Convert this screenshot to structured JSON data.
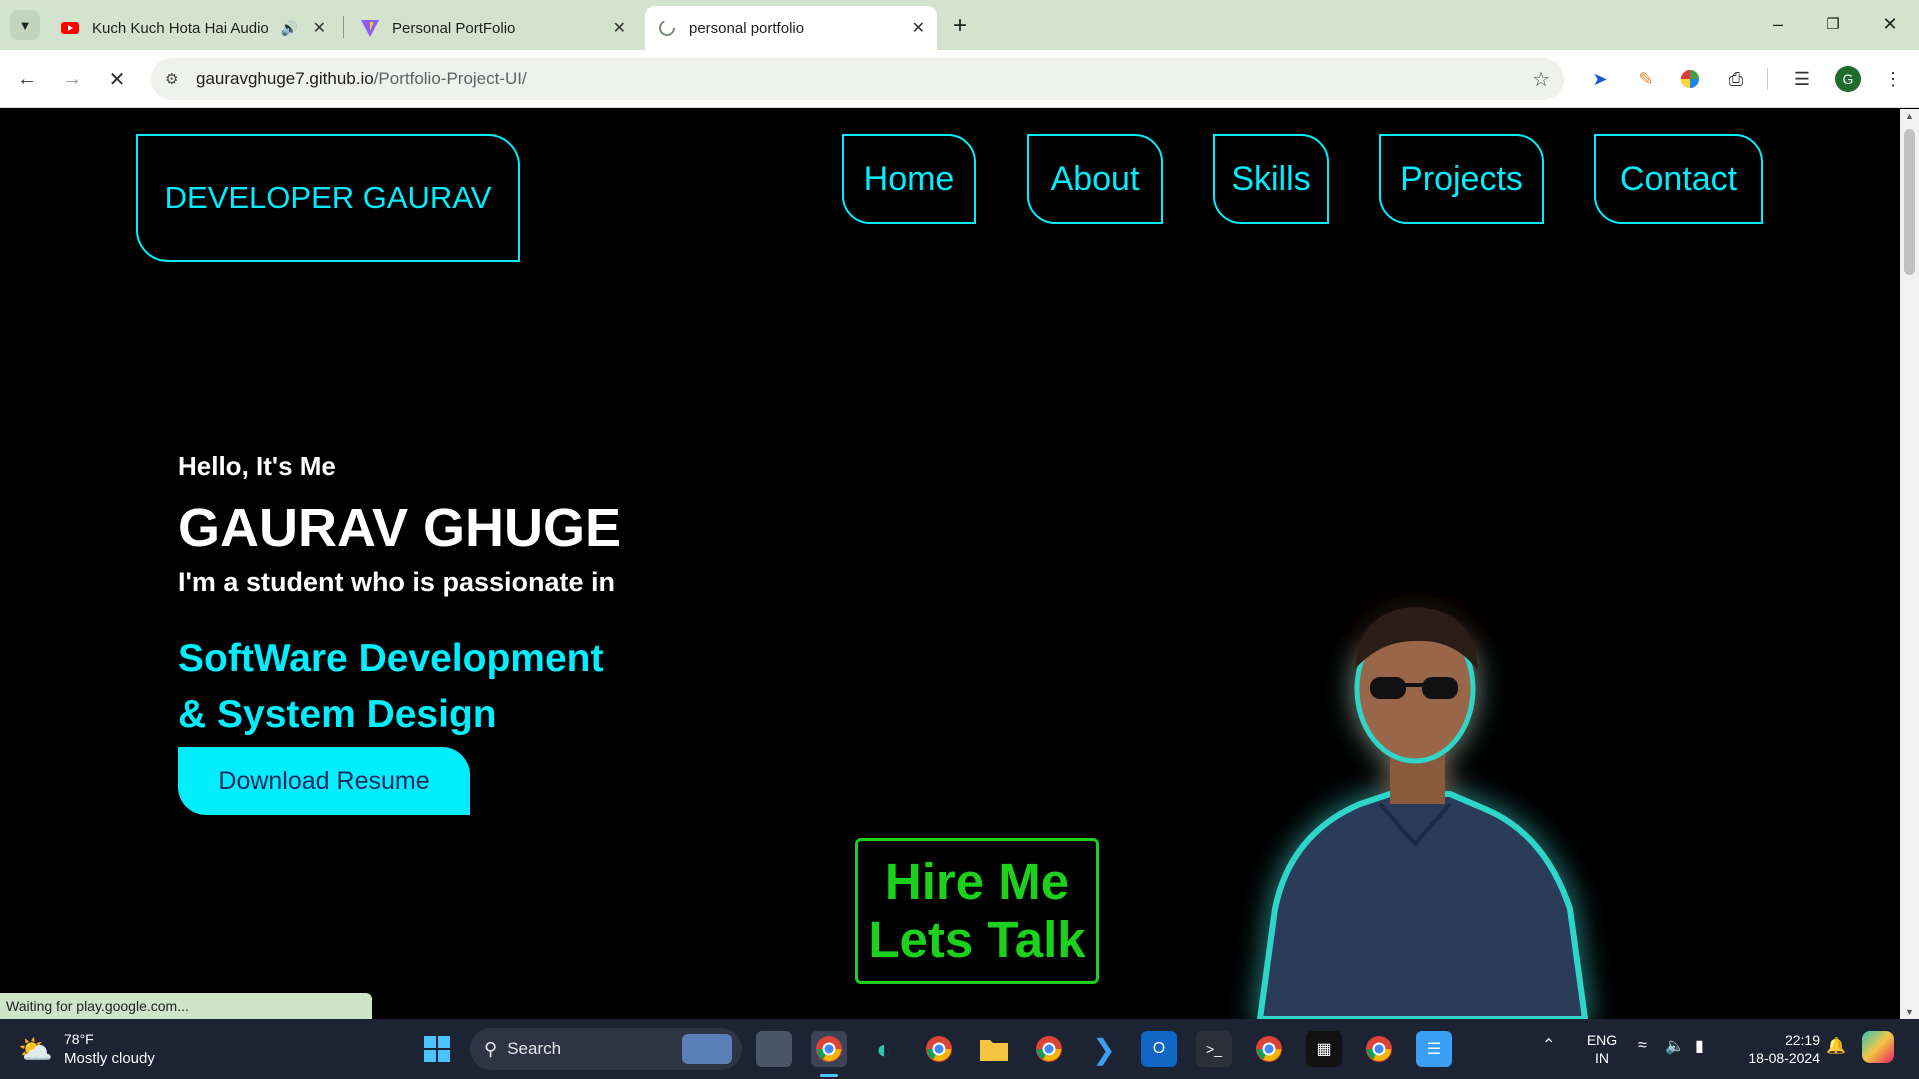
{
  "browser": {
    "tabs": [
      {
        "title": "Kuch Kuch Hota Hai Audio",
        "favicon": "youtube-icon",
        "audio": true
      },
      {
        "title": "Personal PortFolio",
        "favicon": "vite-icon"
      },
      {
        "title": "personal portfolio",
        "favicon": "loading-icon",
        "active": true
      }
    ],
    "url_host": "gauravghuge7.github.io",
    "url_path": "/Portfolio-Project-UI/",
    "status_text": "Waiting for play.google.com...",
    "profile_initial": "G"
  },
  "site": {
    "logo": "DEVELOPER GAURAV",
    "nav": [
      "Home",
      "About",
      "Skills",
      "Projects",
      "Contact"
    ],
    "hero": {
      "greeting": "Hello, It's Me",
      "name": "GAURAV GHUGE",
      "tagline": "I'm a student who is passionate in",
      "skill_line1": "SoftWare Development",
      "skill_line2": "& System Design",
      "cta": "Download Resume",
      "hire_line1": "Hire Me",
      "hire_line2": "Lets Talk"
    },
    "colors": {
      "accent": "#00eeff",
      "hire": "#1bd11b",
      "background": "#000000"
    }
  },
  "taskbar": {
    "weather_temp": "78°F",
    "weather_desc": "Mostly cloudy",
    "search_label": "Search",
    "language_top": "ENG",
    "language_bottom": "IN",
    "time": "22:19",
    "date": "18-08-2024"
  }
}
